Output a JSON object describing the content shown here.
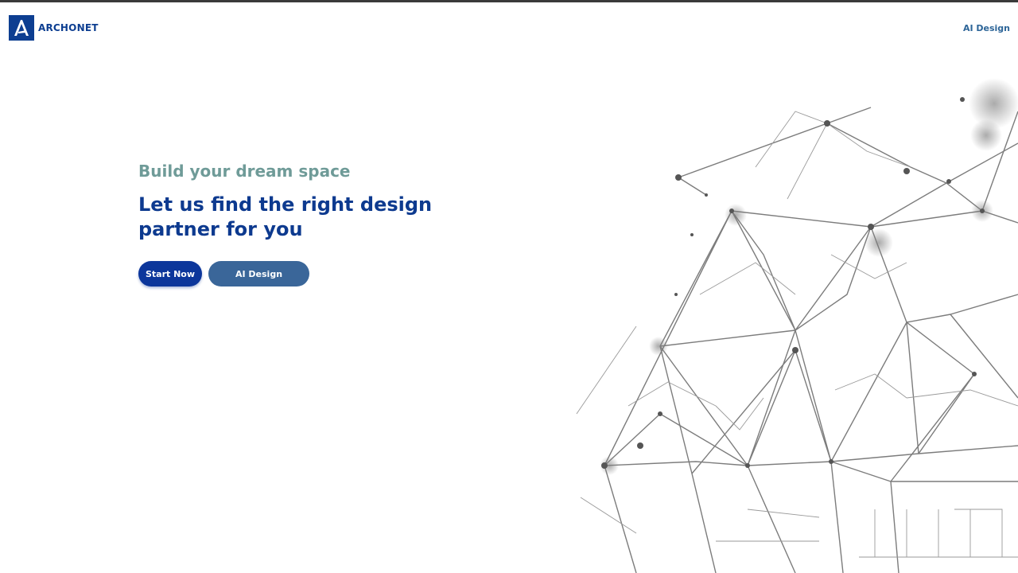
{
  "brand": {
    "name": "ARCHONET",
    "color": "#0d3e91",
    "icon": "logo-icon"
  },
  "nav": {
    "ai_design_link": "AI Design"
  },
  "hero": {
    "eyebrow": "Build your dream space",
    "headline_line1": "Let us find the right design",
    "headline_line2": "partner for you",
    "primary_button": "Start Now",
    "secondary_button": "AI Design"
  },
  "colors": {
    "accent_primary": "#0c369b",
    "accent_secondary": "#3a6699",
    "eyebrow": "#6f9b98"
  },
  "illustration": {
    "icon": "wireframe-house-sketch"
  }
}
